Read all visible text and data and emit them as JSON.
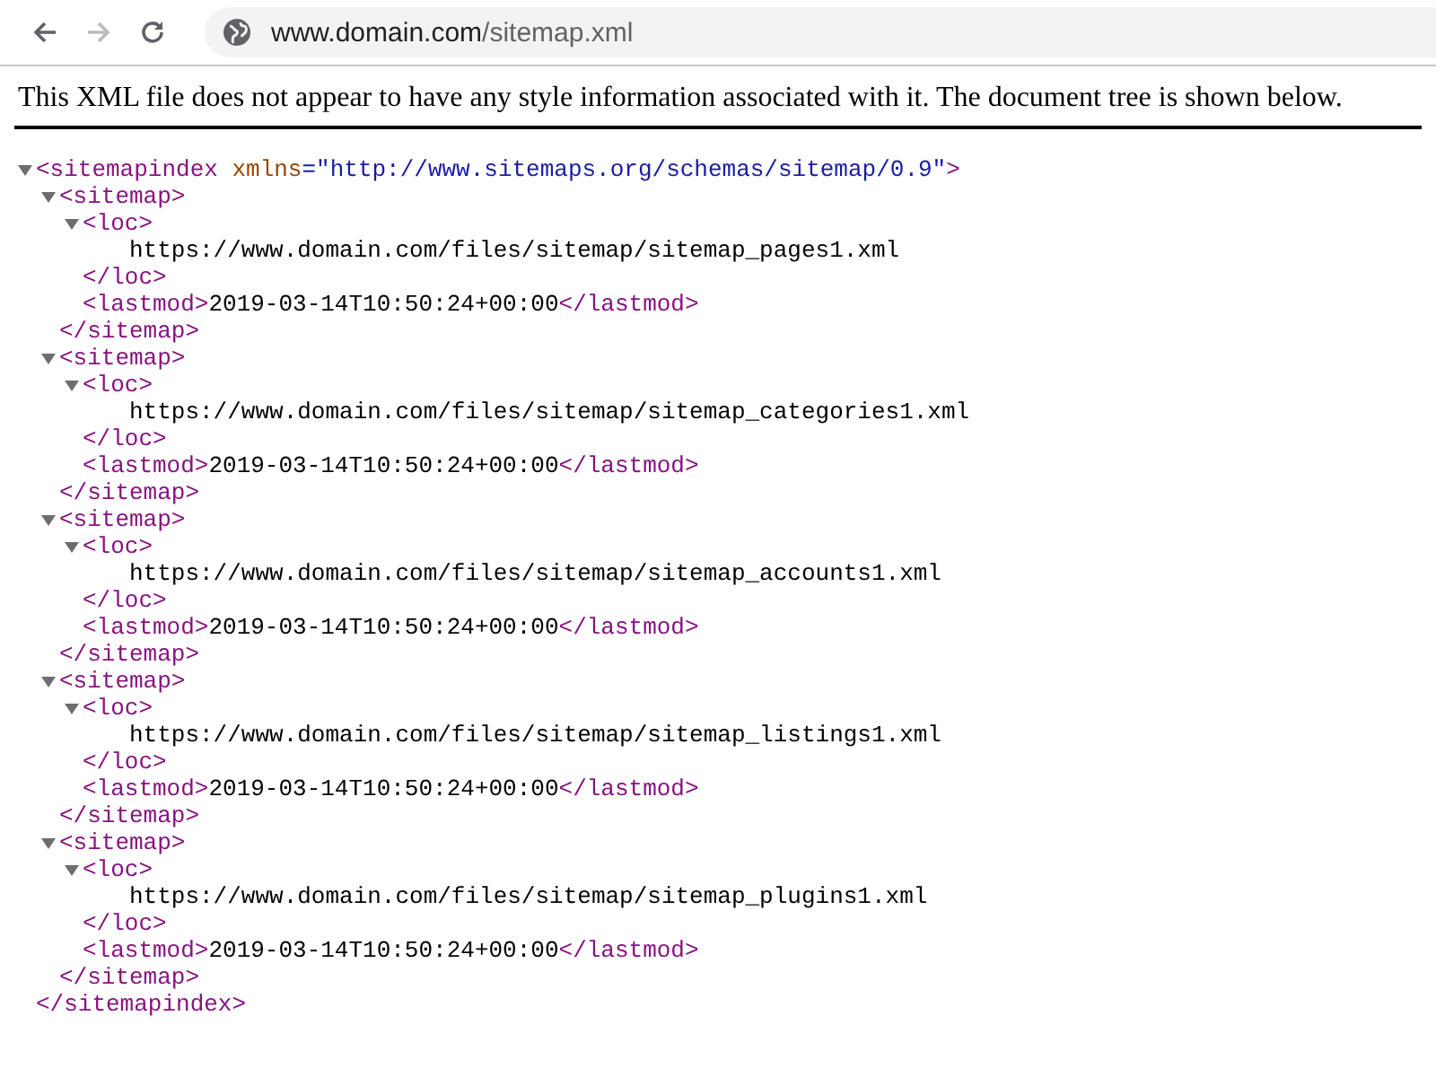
{
  "browser": {
    "back_enabled": true,
    "forward_enabled": false,
    "url_host": "www.domain.com",
    "url_path": "/sitemap.xml"
  },
  "notice": "This XML file does not appear to have any style information associated with it. The document tree is shown below.",
  "xml_tree": [
    {
      "kind": "element",
      "expanded": true,
      "open": [
        {
          "kind": "tag",
          "text": "<sitemapindex"
        },
        {
          "kind": "attr",
          "text": " xmlns"
        },
        {
          "kind": "value",
          "text": "=\"http://www.sitemaps.org/schemas/sitemap/0.9\""
        },
        {
          "kind": "tag",
          "text": ">"
        }
      ],
      "close": "</sitemapindex>",
      "children": [
        {
          "kind": "element",
          "expanded": true,
          "open": [
            {
              "kind": "tag",
              "text": "<sitemap>"
            }
          ],
          "close": "</sitemap>",
          "children": [
            {
              "kind": "element",
              "expanded": true,
              "open": [
                {
                  "kind": "tag",
                  "text": "<loc>"
                }
              ],
              "close": "</loc>",
              "children": [
                {
                  "kind": "text",
                  "text": "https://www.domain.com/files/sitemap/sitemap_pages1.xml"
                }
              ]
            },
            {
              "kind": "inline",
              "open": "<lastmod>",
              "text": "2019-03-14T10:50:24+00:00",
              "close": "</lastmod>"
            }
          ]
        },
        {
          "kind": "element",
          "expanded": true,
          "open": [
            {
              "kind": "tag",
              "text": "<sitemap>"
            }
          ],
          "close": "</sitemap>",
          "children": [
            {
              "kind": "element",
              "expanded": true,
              "open": [
                {
                  "kind": "tag",
                  "text": "<loc>"
                }
              ],
              "close": "</loc>",
              "children": [
                {
                  "kind": "text",
                  "text": "https://www.domain.com/files/sitemap/sitemap_categories1.xml"
                }
              ]
            },
            {
              "kind": "inline",
              "open": "<lastmod>",
              "text": "2019-03-14T10:50:24+00:00",
              "close": "</lastmod>"
            }
          ]
        },
        {
          "kind": "element",
          "expanded": true,
          "open": [
            {
              "kind": "tag",
              "text": "<sitemap>"
            }
          ],
          "close": "</sitemap>",
          "children": [
            {
              "kind": "element",
              "expanded": true,
              "open": [
                {
                  "kind": "tag",
                  "text": "<loc>"
                }
              ],
              "close": "</loc>",
              "children": [
                {
                  "kind": "text",
                  "text": "https://www.domain.com/files/sitemap/sitemap_accounts1.xml"
                }
              ]
            },
            {
              "kind": "inline",
              "open": "<lastmod>",
              "text": "2019-03-14T10:50:24+00:00",
              "close": "</lastmod>"
            }
          ]
        },
        {
          "kind": "element",
          "expanded": true,
          "open": [
            {
              "kind": "tag",
              "text": "<sitemap>"
            }
          ],
          "close": "</sitemap>",
          "children": [
            {
              "kind": "element",
              "expanded": true,
              "open": [
                {
                  "kind": "tag",
                  "text": "<loc>"
                }
              ],
              "close": "</loc>",
              "children": [
                {
                  "kind": "text",
                  "text": "https://www.domain.com/files/sitemap/sitemap_listings1.xml"
                }
              ]
            },
            {
              "kind": "inline",
              "open": "<lastmod>",
              "text": "2019-03-14T10:50:24+00:00",
              "close": "</lastmod>"
            }
          ]
        },
        {
          "kind": "element",
          "expanded": true,
          "open": [
            {
              "kind": "tag",
              "text": "<sitemap>"
            }
          ],
          "close": "</sitemap>",
          "children": [
            {
              "kind": "element",
              "expanded": true,
              "open": [
                {
                  "kind": "tag",
                  "text": "<loc>"
                }
              ],
              "close": "</loc>",
              "children": [
                {
                  "kind": "text",
                  "text": "https://www.domain.com/files/sitemap/sitemap_plugins1.xml"
                }
              ]
            },
            {
              "kind": "inline",
              "open": "<lastmod>",
              "text": "2019-03-14T10:50:24+00:00",
              "close": "</lastmod>"
            }
          ]
        }
      ]
    }
  ]
}
